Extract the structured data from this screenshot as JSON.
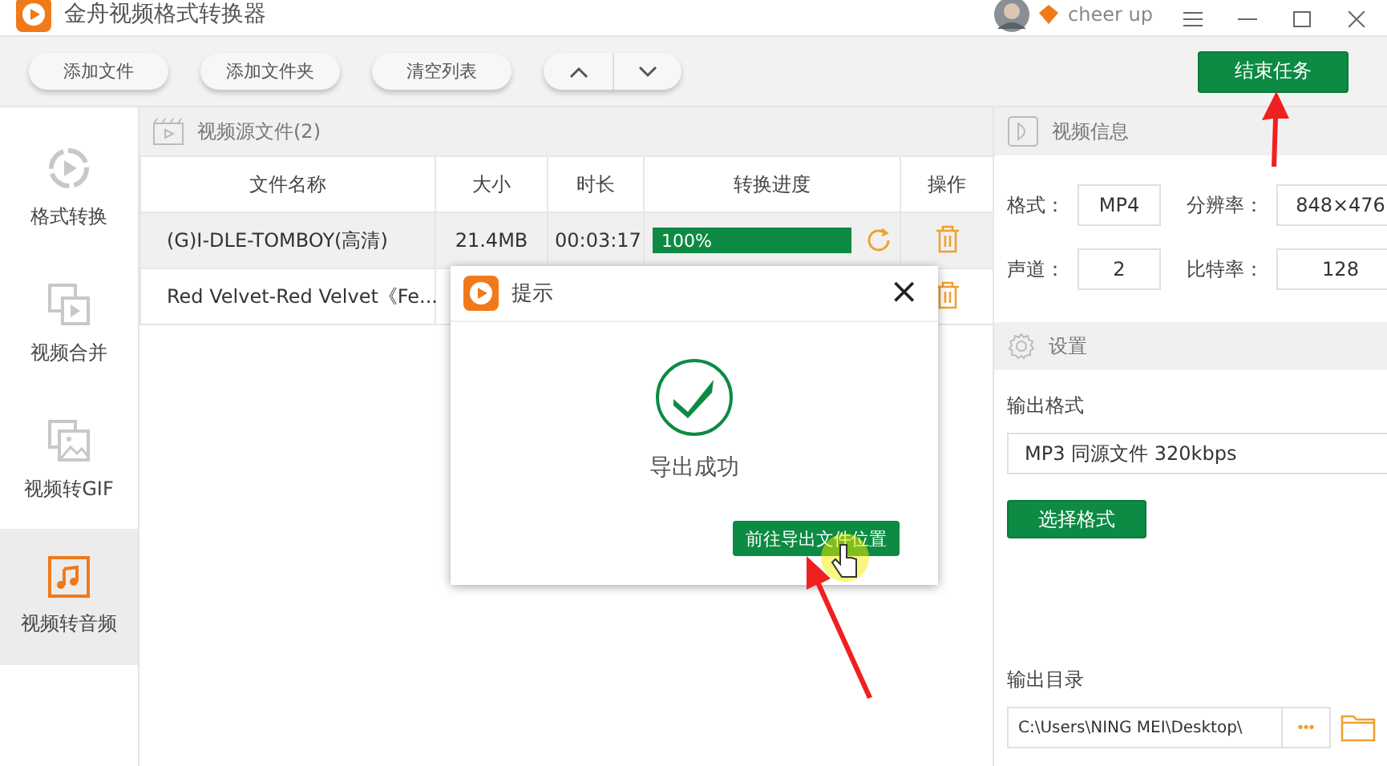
{
  "window": {
    "title": "金舟视频格式转换器",
    "user": "cheer up"
  },
  "toolbar": {
    "buttons": [
      "添加文件",
      "添加文件夹",
      "清空列表"
    ],
    "end_task": "结束任务"
  },
  "sidebar": {
    "items": [
      {
        "label": "格式转换",
        "kind": "convert",
        "selected": false
      },
      {
        "label": "视频合并",
        "kind": "merge",
        "selected": false
      },
      {
        "label": "视频转GIF",
        "kind": "gif",
        "selected": false
      },
      {
        "label": "视频转音频",
        "kind": "audio",
        "selected": true
      }
    ]
  },
  "file_list": {
    "title": "视频源文件(2)",
    "columns": [
      "文件名称",
      "大小",
      "时长",
      "转换进度",
      "操作"
    ],
    "rows": [
      {
        "name": "(G)I-DLE-TOMBOY(高清)",
        "size": "21.4MB",
        "duration": "00:03:17",
        "progress": {
          "level": 1,
          "text": "100%"
        }
      },
      {
        "name": "Red Velvet-Red Velvet《Fe..."
      }
    ]
  },
  "video_info": {
    "title": "视频信息",
    "fields": [
      {
        "label": "格式：",
        "value": "MP4"
      },
      {
        "label": "分辨率：",
        "value": "848×476"
      },
      {
        "label": "声道：",
        "value": "2"
      },
      {
        "label": "比特率：",
        "value": "128"
      }
    ]
  },
  "settings": {
    "title": "设置",
    "output_format_label": "输出格式",
    "output_format": "MP3 同源文件 320kbps",
    "choose_button": "选择格式",
    "output_dir_label": "输出目录",
    "output_dir": "C:\\Users\\NING MEI\\Desktop\\",
    "browse": "•••"
  },
  "dialog": {
    "title": "提示",
    "message": "导出成功",
    "button": "前往导出文件位置",
    "close": "×"
  }
}
